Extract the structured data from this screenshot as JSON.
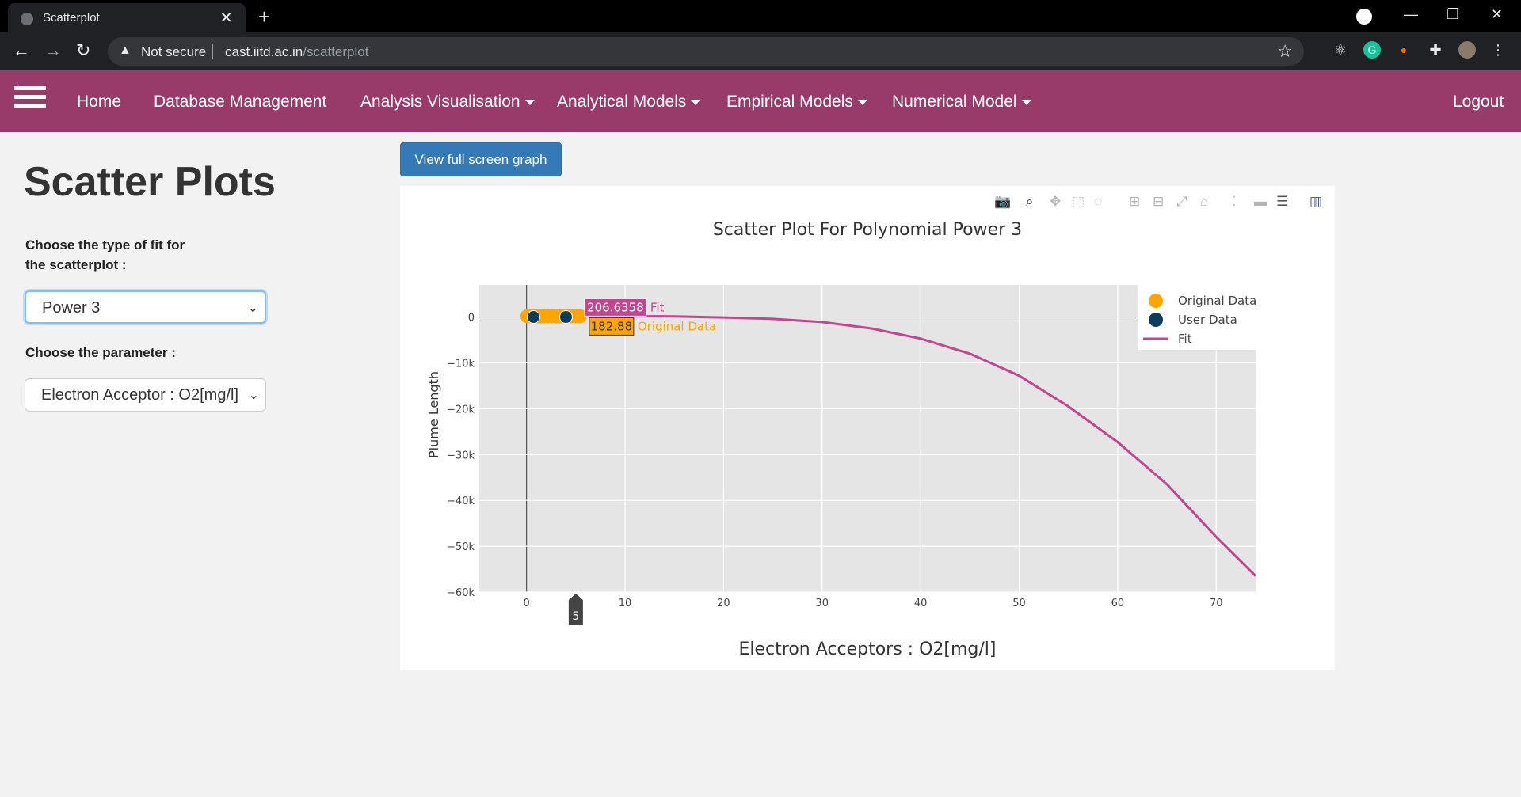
{
  "browser": {
    "tab_title": "Scatterplot",
    "tab_close": "✕",
    "new_tab": "+",
    "security_label": "Not secure",
    "url_host": "cast.iitd.ac.in",
    "url_path": "/scatterplot"
  },
  "navbar": {
    "home": "Home",
    "database": "Database Management",
    "analysis": "Analysis Visualisation",
    "analytical": "Analytical Models",
    "empirical": "Empirical Models",
    "numerical": "Numerical Model",
    "logout": "Logout"
  },
  "sidebar": {
    "title": "Scatter Plots",
    "fit_label": "Choose the type of fit for the scatterplot :",
    "fit_value": "Power 3",
    "param_label": "Choose the parameter :",
    "param_value": "Electron Acceptor : O2[mg/l]"
  },
  "fullscreen_button": "View full screen graph",
  "chart_data": {
    "type": "scatter",
    "title": "Scatter Plot For Polynomial Power 3",
    "xlabel": "Electron Acceptors : O2[mg/l]",
    "ylabel": "Plume Length",
    "xlim": [
      -4.8,
      74
    ],
    "ylim": [
      -60000,
      7000
    ],
    "x_ticks": [
      0,
      10,
      20,
      30,
      40,
      50,
      60,
      70
    ],
    "x_tick_labels": [
      "0",
      "10",
      "20",
      "30",
      "40",
      "50",
      "60",
      "70"
    ],
    "y_ticks": [
      0,
      -10000,
      -20000,
      -30000,
      -40000,
      -50000,
      -60000
    ],
    "y_tick_labels": [
      "0",
      "−10k",
      "−20k",
      "−30k",
      "−40k",
      "−50k",
      "−60k"
    ],
    "grid": true,
    "legend_position": "top-right",
    "series": [
      {
        "name": "Original Data",
        "kind": "markers",
        "color": "#ffa500",
        "x": [
          0.1,
          0.4,
          0.7,
          1.0,
          1.4,
          1.8,
          2.2,
          2.6,
          3.0,
          3.4,
          3.8,
          4.2,
          4.6,
          5.0,
          5.4
        ],
        "y": [
          180,
          160,
          190,
          170,
          150,
          175,
          165,
          180,
          160,
          170,
          155,
          182,
          183,
          170,
          160
        ]
      },
      {
        "name": "User Data",
        "kind": "markers",
        "color": "#0d3b5c",
        "x": [
          0.7,
          4.0
        ],
        "y": [
          0,
          0
        ]
      },
      {
        "name": "Fit",
        "kind": "line",
        "color": "#c2468f",
        "x": [
          0,
          5,
          10,
          15,
          20,
          25,
          30,
          35,
          40,
          45,
          50,
          55,
          60,
          65,
          70,
          74
        ],
        "y": [
          150,
          190,
          200,
          120,
          -100,
          -400,
          -1100,
          -2500,
          -4700,
          -8000,
          -12800,
          -19500,
          -27300,
          -36500,
          -48000,
          -56500
        ]
      }
    ],
    "hover": {
      "x_label": "5",
      "fit_value": "206.6358",
      "fit_name": "Fit",
      "orig_value": "182.88",
      "orig_name": "Original Data"
    }
  }
}
